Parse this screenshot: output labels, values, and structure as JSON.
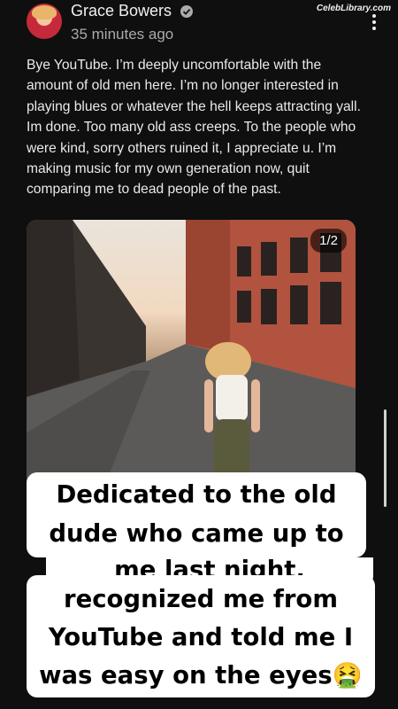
{
  "watermark": "CelebLibrary.com",
  "post": {
    "author": "Grace Bowers",
    "time": "35 minutes ago",
    "text": "Bye YouTube. I’m deeply uncomfortable with the amount of old men here. I’m no longer interested in playing blues or whatever the hell keeps attracting yall. Im done. Too many old ass creeps. To the people who were kind, sorry others ruined it, I appreciate u. I’m making music for my own generation now, quit comparing me to dead people of the past.",
    "image_counter": "1/2"
  },
  "caption": {
    "lines": [
      "Dedicated to the old",
      "dude who came up to",
      "me last night,",
      "recognized me from",
      "YouTube and told me I",
      "was easy on the eyes🤮"
    ]
  },
  "icons": {
    "verified": "verified-badge-icon",
    "menu": "more-vertical-icon"
  }
}
